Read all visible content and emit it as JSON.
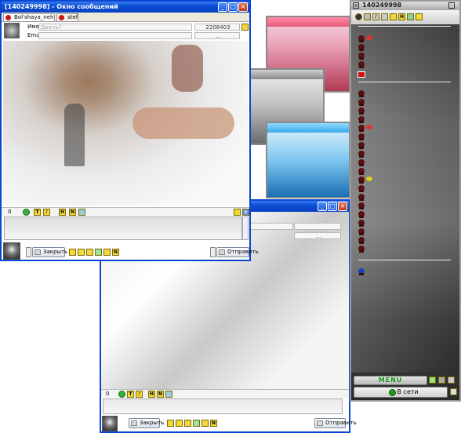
{
  "win1": {
    "title": "[140249998] - Окно сообщений",
    "tabs": [
      "Bol'shaya_nehochuha",
      "stef"
    ],
    "name_label": "Имя",
    "name_value": "Двачъ?",
    "uin_value": "2208403",
    "email_label": "Email",
    "email_btn": "...",
    "toolbar_counter": "0",
    "close_btn": "Закрыть",
    "send_btn": "Отправить"
  },
  "win2": {
    "field_a": "",
    "field_b": "...",
    "toolbar_counter": "0",
    "close_btn": "Закрыть",
    "send_btn": "Отправить"
  },
  "cl": {
    "title": "140249998",
    "menu_label": "MENU",
    "status_label": "В сети"
  },
  "colors": {
    "xp_title": "#0a4fd6",
    "online": "#1a9a1a"
  }
}
